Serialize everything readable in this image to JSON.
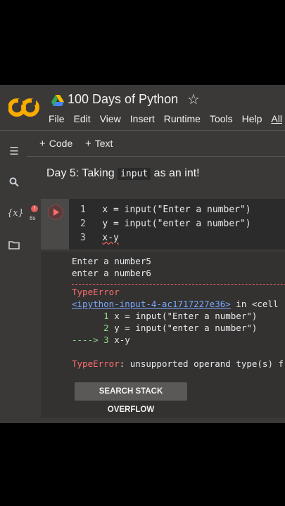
{
  "header": {
    "title": "100 Days of Python",
    "logo_text": "CO",
    "menu": [
      "File",
      "Edit",
      "View",
      "Insert",
      "Runtime",
      "Tools",
      "Help",
      "All"
    ]
  },
  "toolbar": {
    "code_label": "Code",
    "text_label": "Text"
  },
  "text_cell": {
    "prefix": "Day 5: Taking ",
    "code": "input",
    "suffix": " as an int!"
  },
  "code_cell": {
    "exec_count": "8s",
    "badge": "!",
    "lines": [
      {
        "num": "1",
        "text": "x = input(\"Enter a number\")"
      },
      {
        "num": "2",
        "text": "y = input(\"enter a number\")"
      },
      {
        "num": "3",
        "text": "x-y"
      }
    ]
  },
  "output": {
    "stdout": [
      "Enter a number5",
      "enter a number6"
    ],
    "error_name": "TypeError",
    "traceback_link": "<ipython-input-4-ac1717227e36>",
    "traceback_in": " in <cell",
    "trace": [
      {
        "prefix": "      1 ",
        "text": "x = input(\"Enter a number\")"
      },
      {
        "prefix": "      2 ",
        "text": "y = input(\"enter a number\")"
      },
      {
        "prefix": "----> 3 ",
        "text": "x-y"
      }
    ],
    "error_message_label": "TypeError",
    "error_message": ": unsupported operand type(s) f",
    "stack_overflow_button": "SEARCH STACK OVERFLOW"
  },
  "colors": {
    "error": "#ff6e6e",
    "link": "#7aa7ff",
    "background": "#3a3937"
  }
}
